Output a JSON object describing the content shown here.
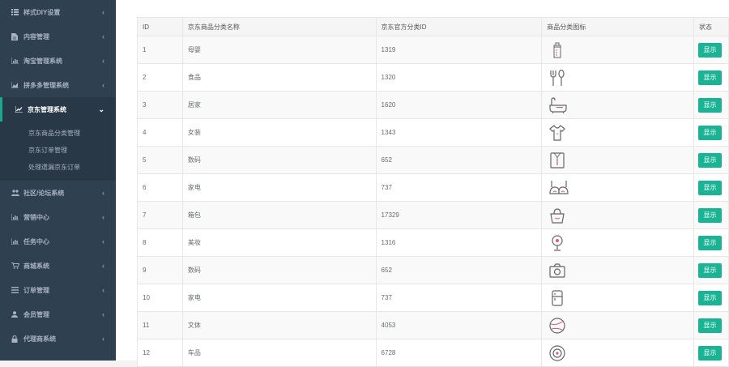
{
  "colors": {
    "sidebar_bg": "#2f4050",
    "accent": "#1ab394"
  },
  "sidebar": {
    "items": [
      {
        "label": "样式DIY设置",
        "icon": "list-icon"
      },
      {
        "label": "内容管理",
        "icon": "file-icon"
      },
      {
        "label": "淘宝管理系统",
        "icon": "bar-chart-icon"
      },
      {
        "label": "拼多多管理系统",
        "icon": "area-chart-icon"
      },
      {
        "label": "京东管理系统",
        "icon": "line-chart-icon",
        "active": true,
        "children": [
          {
            "label": "京东商品分类管理"
          },
          {
            "label": "京东订单管理"
          },
          {
            "label": "处理遗漏京东订单"
          }
        ]
      },
      {
        "label": "社区/论坛系统",
        "icon": "users-icon"
      },
      {
        "label": "营销中心",
        "icon": "bar-chart-icon"
      },
      {
        "label": "任务中心",
        "icon": "bar-chart-icon"
      },
      {
        "label": "商城系统",
        "icon": "cart-icon"
      },
      {
        "label": "订单管理",
        "icon": "menu-icon"
      },
      {
        "label": "会员管理",
        "icon": "user-icon"
      },
      {
        "label": "代理商系统",
        "icon": "lock-icon"
      }
    ]
  },
  "table": {
    "headers": [
      "ID",
      "京东商品分类名称",
      "京东官方分类ID",
      "商品分类图标",
      "状态"
    ],
    "rows": [
      {
        "id": "1",
        "name": "母婴",
        "jd_id": "1319",
        "icon": "baby-bottle-icon",
        "status": "显示"
      },
      {
        "id": "2",
        "name": "食品",
        "jd_id": "1320",
        "icon": "fork-spoon-icon",
        "status": "显示"
      },
      {
        "id": "3",
        "name": "居家",
        "jd_id": "1620",
        "icon": "bathtub-icon",
        "status": "显示"
      },
      {
        "id": "4",
        "name": "女装",
        "jd_id": "1343",
        "icon": "dress-icon",
        "status": "显示"
      },
      {
        "id": "5",
        "name": "数码",
        "jd_id": "652",
        "icon": "shirt-icon",
        "status": "显示"
      },
      {
        "id": "6",
        "name": "家电",
        "jd_id": "737",
        "icon": "bra-icon",
        "status": "显示"
      },
      {
        "id": "7",
        "name": "箱包",
        "jd_id": "17329",
        "icon": "handbag-icon",
        "status": "显示"
      },
      {
        "id": "8",
        "name": "美妆",
        "jd_id": "1316",
        "icon": "mirror-icon",
        "status": "显示"
      },
      {
        "id": "9",
        "name": "数码",
        "jd_id": "652",
        "icon": "camera-icon",
        "status": "显示"
      },
      {
        "id": "10",
        "name": "家电",
        "jd_id": "737",
        "icon": "fridge-icon",
        "status": "显示"
      },
      {
        "id": "11",
        "name": "文体",
        "jd_id": "4053",
        "icon": "ball-icon",
        "status": "显示"
      },
      {
        "id": "12",
        "name": "车品",
        "jd_id": "6728",
        "icon": "tire-icon",
        "status": "显示"
      }
    ]
  }
}
